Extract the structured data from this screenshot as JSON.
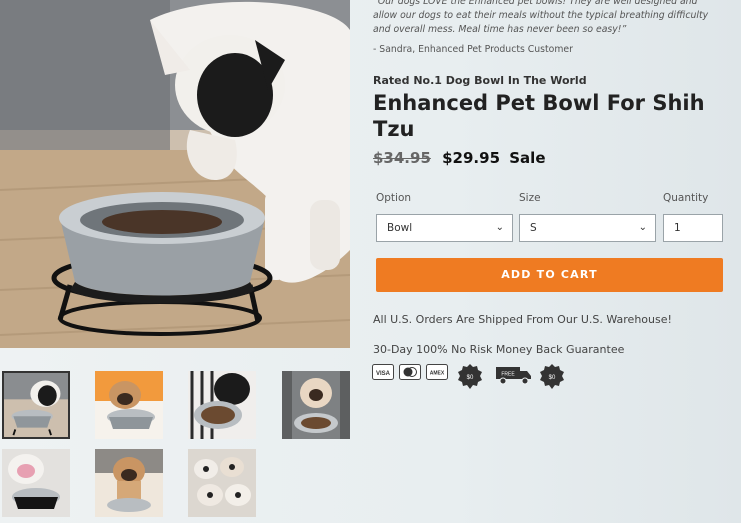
{
  "gallery": {
    "main_image": "french-bulldog-eating-from-elevated-steel-bowl",
    "thumbnails": [
      {
        "name": "thumb-1-white-bulldog-bowl",
        "active": true
      },
      {
        "name": "thumb-2-fawn-bulldog-orange-background",
        "active": false
      },
      {
        "name": "thumb-3-black-dog-kibble-bowl",
        "active": false
      },
      {
        "name": "thumb-4-bulldog-in-crate",
        "active": false
      },
      {
        "name": "thumb-5-bulldog-white",
        "active": false
      },
      {
        "name": "thumb-6-fawn-bulldog-bowl",
        "active": false
      },
      {
        "name": "thumb-7-bulldog-puppies",
        "active": false
      }
    ]
  },
  "review": {
    "quote": "“Our dogs LOVE the Enhanced pet bowls! They are well designed and allow our dogs to eat their meals without the typical breathing difficulty and overall mess. Meal time has never been so easy!”",
    "author": "- Sandra, Enhanced Pet Products Customer"
  },
  "product": {
    "tagline": "Rated No.1 Dog Bowl In The World",
    "title": "Enhanced Pet Bowl For Shih Tzu",
    "price_old": "$34.95",
    "price_new": "$29.95",
    "sale_label": "Sale"
  },
  "options": {
    "option_label": "Option",
    "option_value": "Bowl",
    "size_label": "Size",
    "size_value": "S",
    "quantity_label": "Quantity",
    "quantity_value": "1"
  },
  "cart": {
    "button_label": "ADD TO CART"
  },
  "notes": {
    "shipping": "All U.S. Orders Are Shipped From Our U.S. Warehouse!",
    "guarantee": "30-Day 100% No Risk Money Back Guarantee"
  },
  "trust_badges": {
    "visa": "VISA",
    "amex": "AMEX",
    "coin": "$0",
    "truck": "FREE"
  },
  "colors": {
    "accent": "#ef7b22",
    "text": "#222222"
  }
}
